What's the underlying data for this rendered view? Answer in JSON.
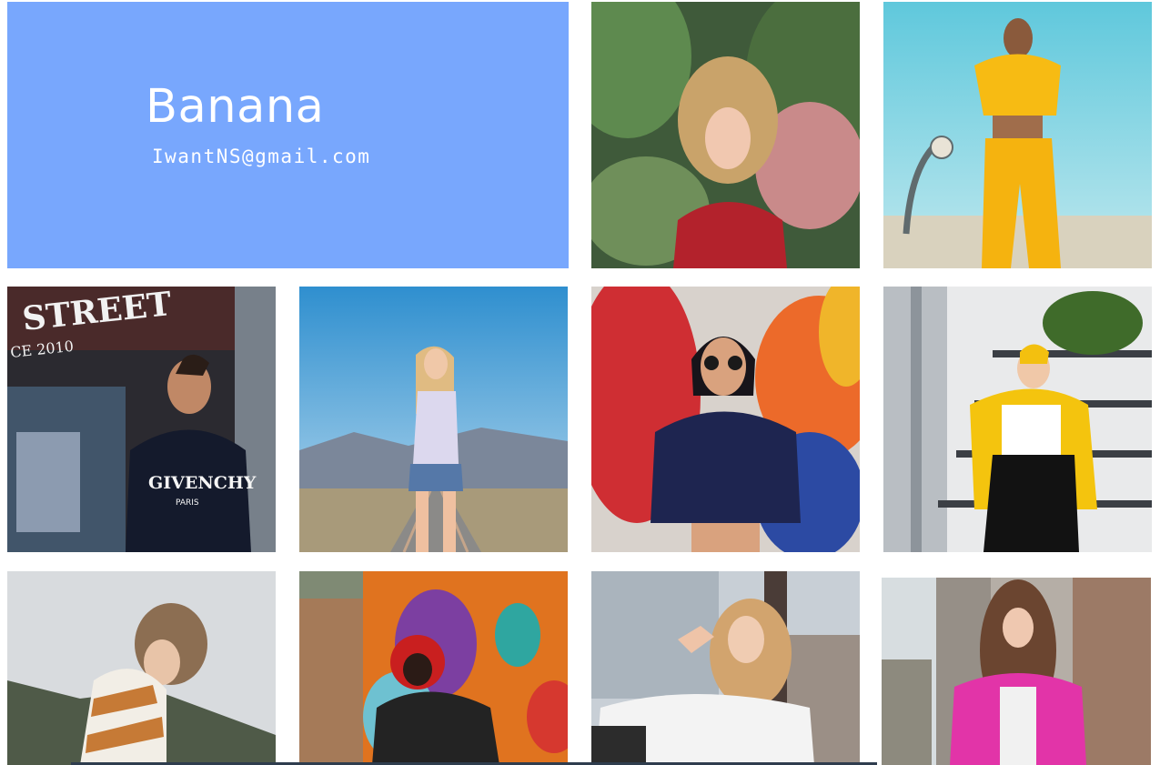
{
  "brand": {
    "name": "Banana",
    "email": "IwantNS@gmail.com",
    "background_color": "#78a7fd"
  },
  "photos": [
    {
      "name": "photo-woman-flowers-red-top"
    },
    {
      "name": "photo-woman-yellow-tracksuit"
    },
    {
      "name": "photo-man-givenchy-street"
    },
    {
      "name": "photo-woman-railway-tracks"
    },
    {
      "name": "photo-woman-sunglasses-graffiti"
    },
    {
      "name": "photo-woman-yellow-jacket-stairs"
    },
    {
      "name": "photo-woman-striped-sweater"
    },
    {
      "name": "photo-man-red-hood-graffiti"
    },
    {
      "name": "photo-woman-white-shirt-rooftop"
    },
    {
      "name": "photo-woman-pink-blazer"
    }
  ],
  "street_sign_text": "STREET",
  "street_sign_sub": "CE 2010",
  "shirt_brand": "GIVENCHY",
  "shirt_city": "PARIS"
}
